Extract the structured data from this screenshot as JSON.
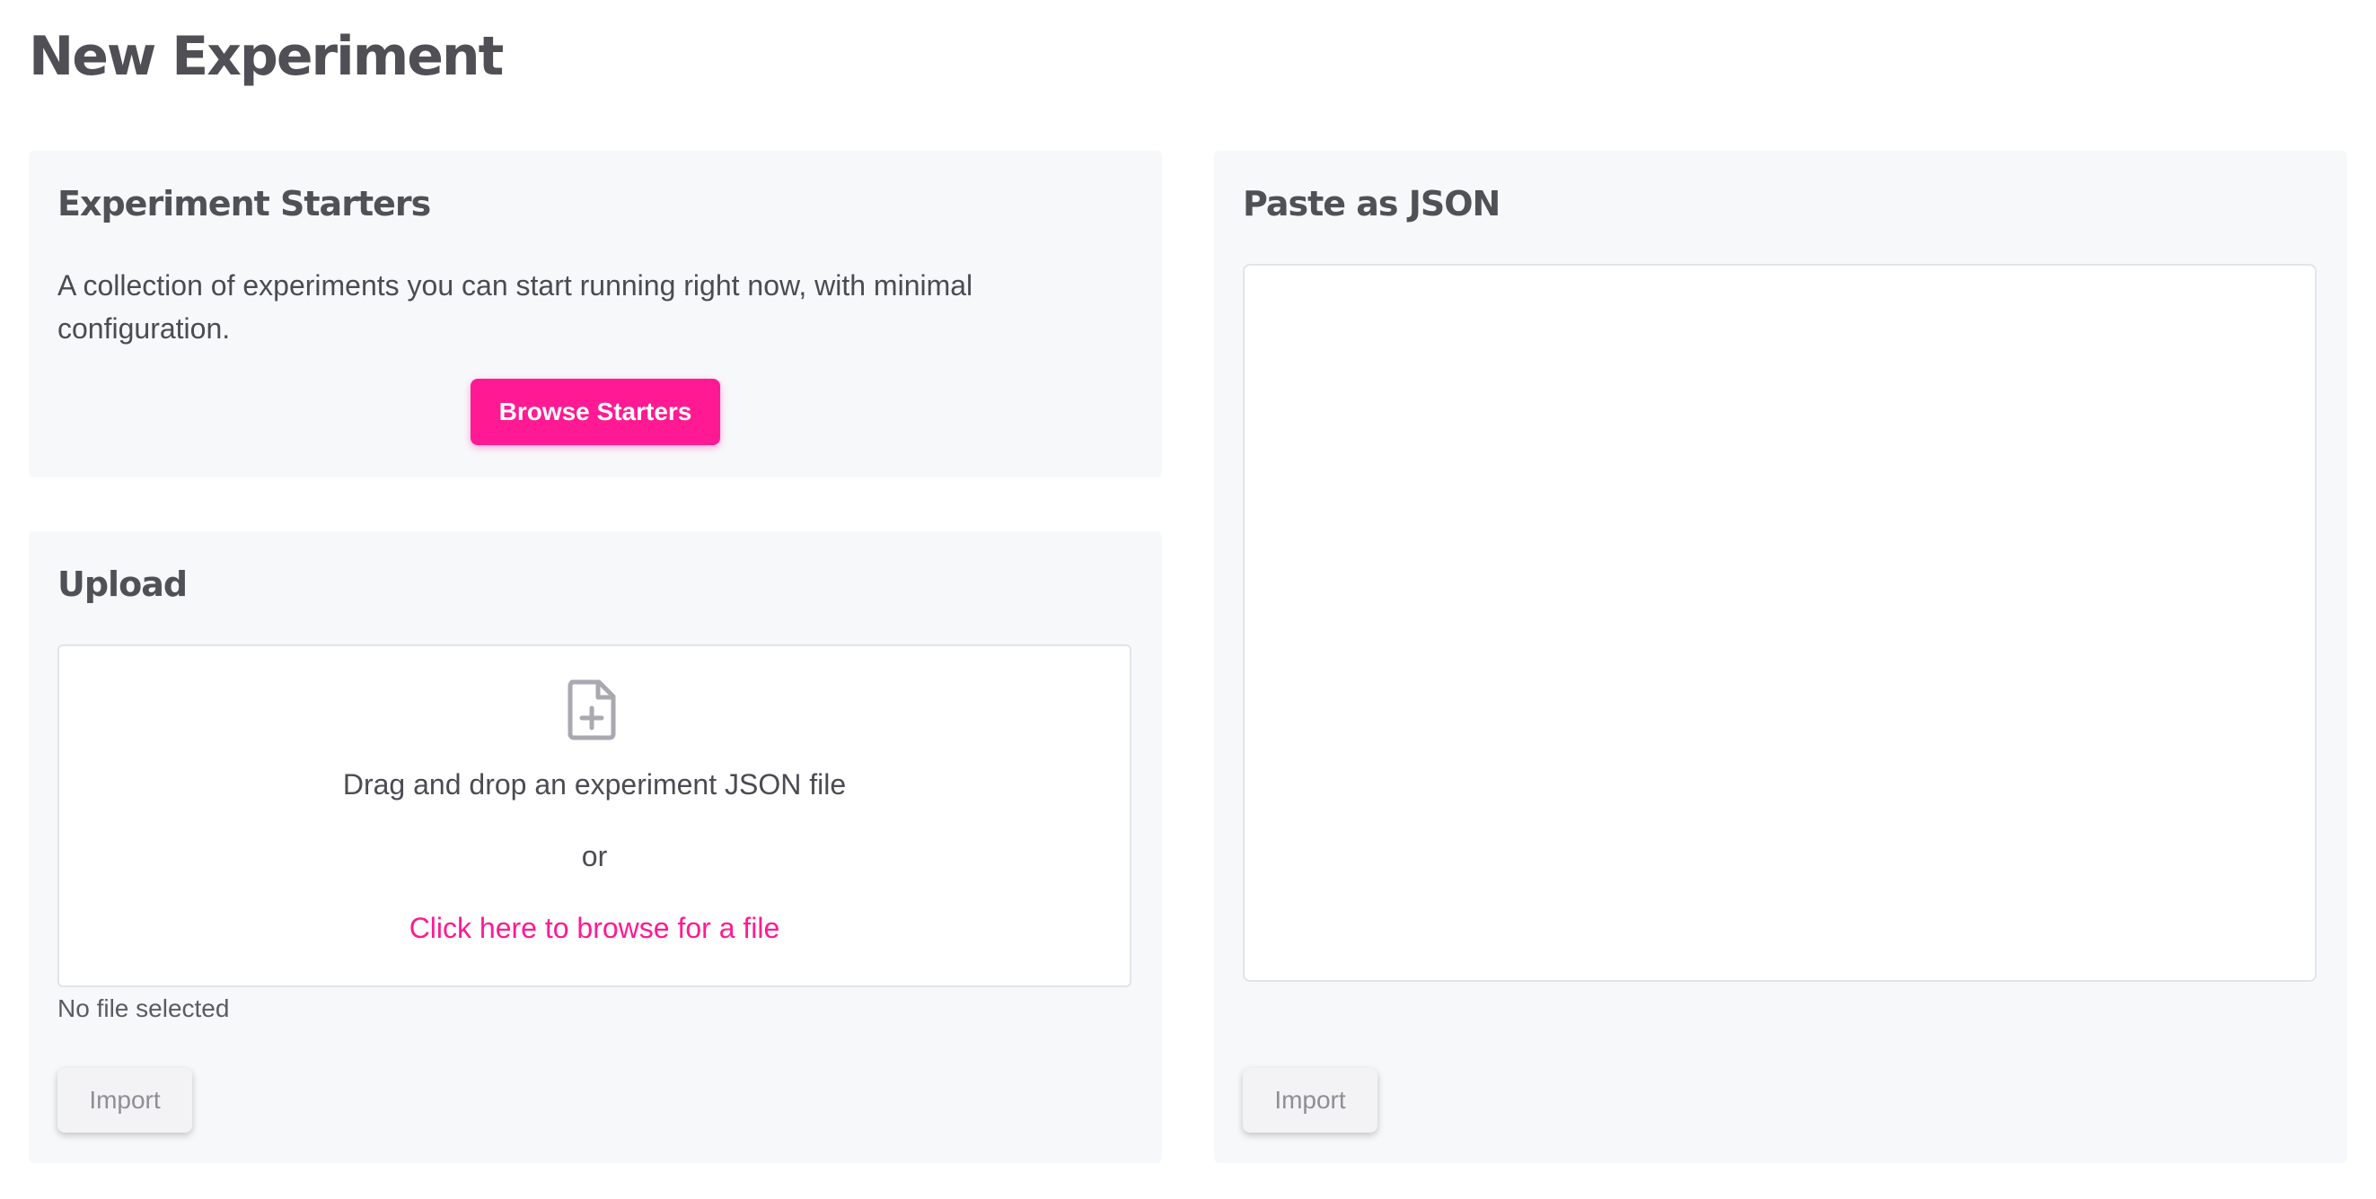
{
  "page": {
    "title": "New Experiment"
  },
  "starters": {
    "heading": "Experiment Starters",
    "description": "A collection of experiments you can start running right now, with minimal configuration.",
    "button_label": "Browse Starters"
  },
  "upload": {
    "heading": "Upload",
    "icon": "file-plus-icon",
    "drop_text": "Drag and drop an experiment JSON file",
    "or_text": "or",
    "browse_link": "Click here to browse for a file",
    "status": "No file selected",
    "import_label": "Import"
  },
  "json": {
    "heading": "Paste as JSON",
    "value": "",
    "import_label": "Import"
  },
  "colors": {
    "accent": "#ff1a93",
    "panel_bg": "#f7f8fa",
    "text": "#4a4a52"
  }
}
